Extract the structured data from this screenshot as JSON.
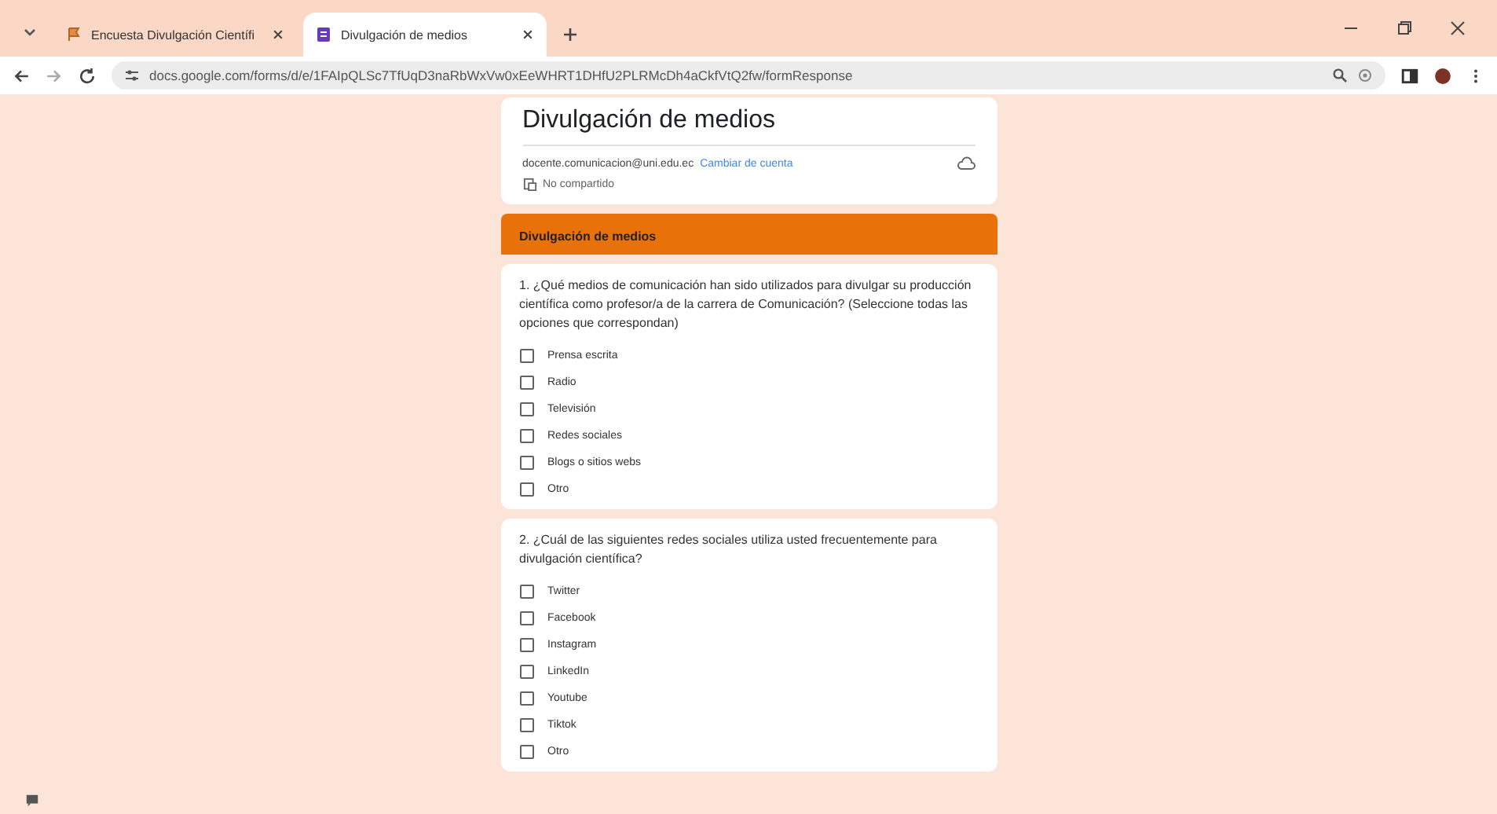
{
  "browser": {
    "tabs": [
      {
        "label": "Encuesta Divulgación Científi",
        "selected": false
      },
      {
        "label": "Divulgación de medios",
        "selected": true
      }
    ],
    "url": "docs.google.com/forms/d/e/1FAIpQLSc7TfUqD3naRbWxVw0xEeWHRT1DHfU2PLRMcDh4aCkfVtQ2fw/formResponse"
  },
  "form": {
    "title": "Divulgación de medios",
    "account": "docente.comunicacion@uni.edu.ec",
    "switch_account": "Cambiar de cuenta",
    "shared_status": "No compartido"
  },
  "section": {
    "title": "Divulgación de medios"
  },
  "questions": [
    {
      "text": "1. ¿Qué medios de comunicación han sido utilizados para divulgar su producción científica como profesor/a de la carrera de Comunicación? (Seleccione todas las opciones que correspondan)",
      "options": [
        {
          "label": "Prensa escrita",
          "checked": false
        },
        {
          "label": "Radio",
          "checked": false
        },
        {
          "label": "Televisión",
          "checked": false
        },
        {
          "label": "Redes sociales",
          "checked": false
        },
        {
          "label": "Blogs o sitios webs",
          "checked": false
        },
        {
          "label": "Otro",
          "checked": false
        }
      ]
    },
    {
      "text": "2. ¿Cuál de las siguientes redes sociales utiliza usted frecuentemente para divulgación científica?",
      "options": [
        {
          "label": "Twitter",
          "checked": false
        },
        {
          "label": "Facebook",
          "checked": false
        },
        {
          "label": "Instagram",
          "checked": false
        },
        {
          "label": "LinkedIn",
          "checked": false
        },
        {
          "label": "Youtube",
          "checked": false
        },
        {
          "label": "Tiktok",
          "checked": false
        },
        {
          "label": "Otro",
          "checked": false
        }
      ]
    }
  ]
}
